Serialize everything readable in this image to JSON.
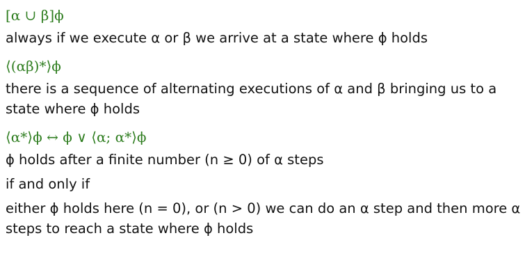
{
  "blocks": [
    {
      "formula": "[α ∪ β]ϕ",
      "text": "always if we execute α or β we arrive at a state where ϕ holds"
    },
    {
      "formula": "⟨(αβ)*⟩ϕ",
      "text": "there is a sequence of alternating executions of α and β bringing us to a state where ϕ holds"
    },
    {
      "formula": "⟨α*⟩ϕ ↔ ϕ ∨ ⟨α; α*⟩ϕ",
      "text_1": "ϕ holds after a finite number (n ≥ 0) of α steps",
      "text_2": "if and only if",
      "text_3": "either ϕ holds here (n = 0), or (n > 0) we can do an α step and then more α steps to reach a state where ϕ holds"
    }
  ],
  "colors": {
    "formula": "#2e7d1f",
    "text": "#111111",
    "background": "#ffffff"
  }
}
